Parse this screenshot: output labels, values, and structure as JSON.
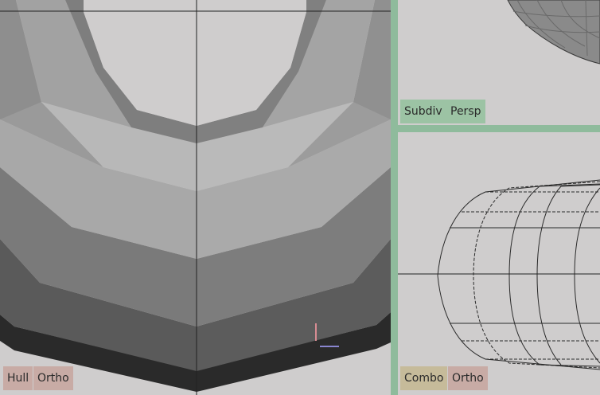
{
  "viewports": {
    "main": {
      "labels": [
        "Hull",
        "Ortho"
      ]
    },
    "top_right": {
      "labels": [
        "Subdiv",
        "Persp"
      ]
    },
    "bottom_right": {
      "labels": [
        "Combo",
        "Ortho"
      ]
    }
  },
  "colors": {
    "background": "#cfcdcd",
    "separator": "#8fbb9c",
    "tag_red": "#c8aba5",
    "tag_green": "#9cc3a4",
    "tag_yellow": "#c6bb9a",
    "axis_x": "#8a86d0",
    "axis_y": "#d88c93"
  }
}
